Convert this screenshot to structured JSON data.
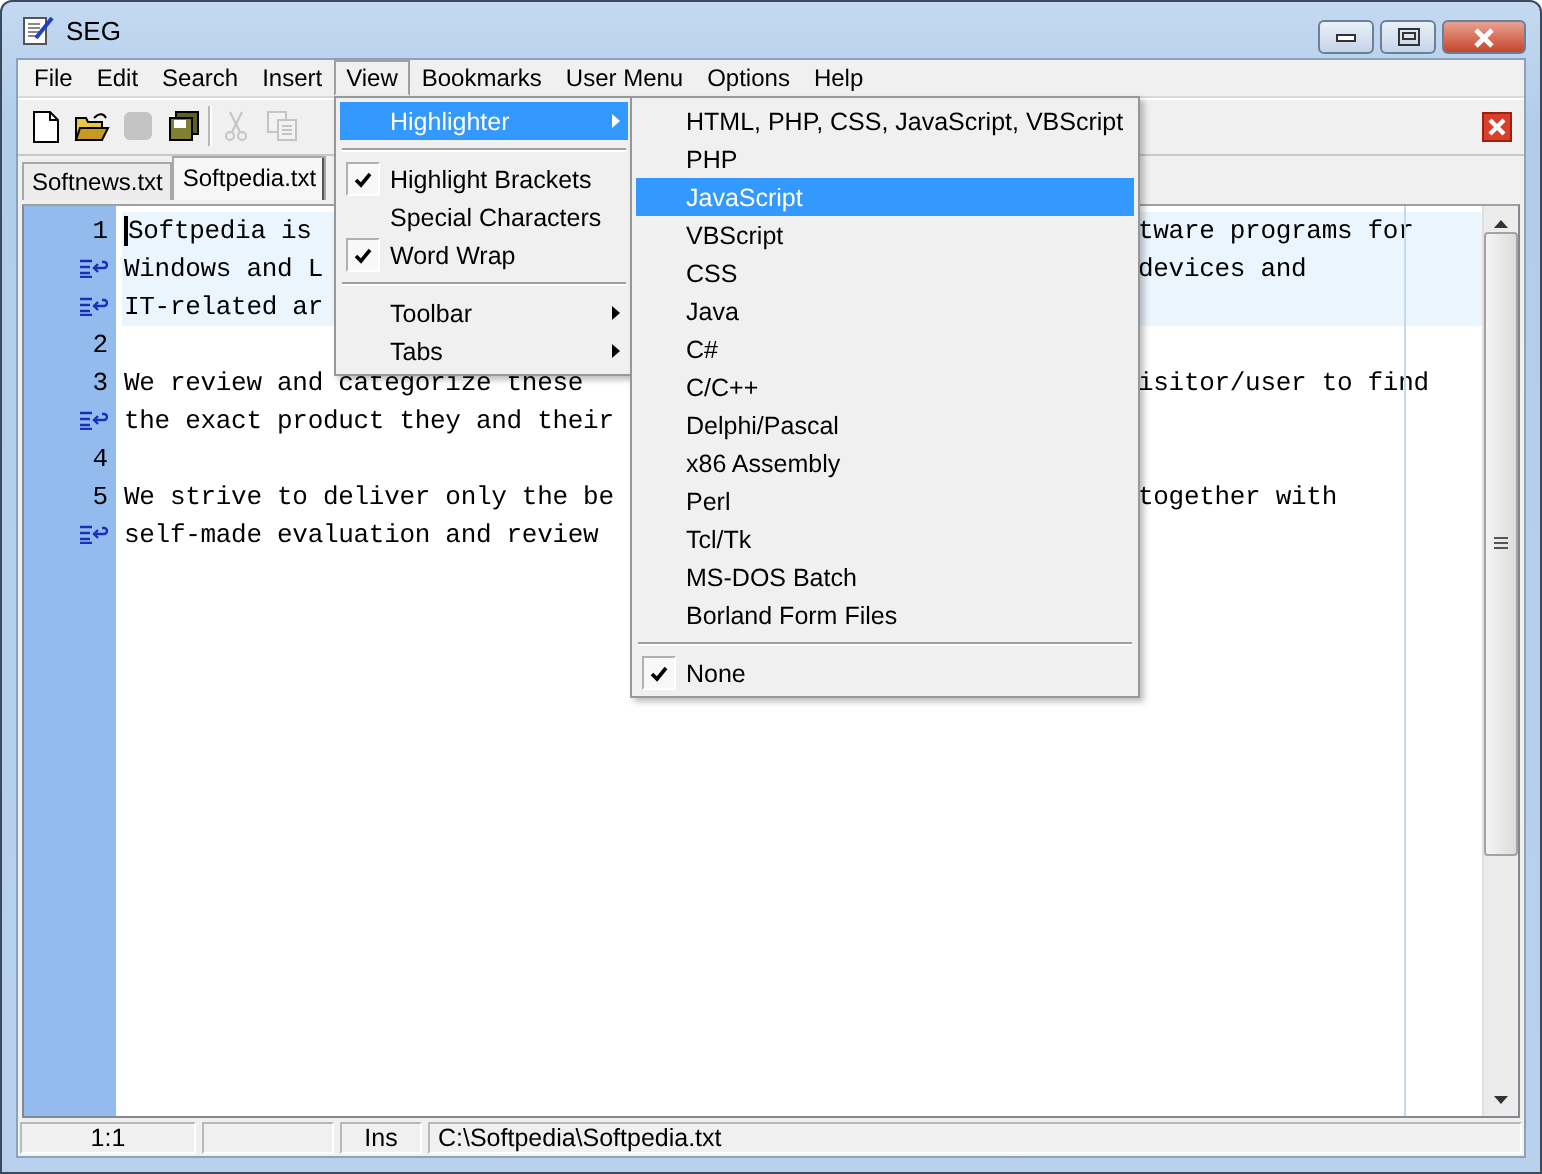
{
  "window": {
    "title": "SEG"
  },
  "menu_bar": [
    {
      "label": "File",
      "open": false
    },
    {
      "label": "Edit",
      "open": false
    },
    {
      "label": "Search",
      "open": false
    },
    {
      "label": "Insert",
      "open": false
    },
    {
      "label": "View",
      "open": true
    },
    {
      "label": "Bookmarks",
      "open": false
    },
    {
      "label": "User Menu",
      "open": false
    },
    {
      "label": "Options",
      "open": false
    },
    {
      "label": "Help",
      "open": false
    }
  ],
  "toolbar": [
    {
      "kind": "new",
      "disabled": false
    },
    {
      "kind": "open",
      "disabled": false
    },
    {
      "kind": "save",
      "disabled": true
    },
    {
      "kind": "save-all",
      "disabled": false
    },
    {
      "kind": "cut",
      "disabled": true
    },
    {
      "kind": "copy",
      "disabled": true
    }
  ],
  "tabs": [
    {
      "label": "Softnews.txt",
      "selected": false
    },
    {
      "label": "Softpedia.txt",
      "selected": true
    }
  ],
  "editor": {
    "lines": [
      {
        "kind": "line",
        "number": "1",
        "current": true,
        "text": "Softpedia is",
        "text_right": "tware programs for"
      },
      {
        "kind": "wrap",
        "current": true,
        "text": "Windows and L",
        "text_right": "devices and"
      },
      {
        "kind": "wrap",
        "current": true,
        "text": "IT-related ar"
      },
      {
        "kind": "line",
        "number": "2",
        "current": false
      },
      {
        "kind": "line",
        "number": "3",
        "current": false,
        "text": "We review and categorize these",
        "text_right": "isitor/user to find"
      },
      {
        "kind": "wrap",
        "current": false,
        "text": "the exact product they and their"
      },
      {
        "kind": "line",
        "number": "4",
        "current": false
      },
      {
        "kind": "line",
        "number": "5",
        "current": false,
        "text": "We strive to deliver only the be",
        "text_right": "together with"
      },
      {
        "kind": "wrap",
        "current": false,
        "text": "self-made evaluation and review"
      }
    ]
  },
  "view_menu": {
    "items": [
      {
        "kind": "item",
        "label": "Highlighter",
        "selected": true,
        "checked": false,
        "submenu": true
      },
      {
        "kind": "separator"
      },
      {
        "kind": "item",
        "label": "Highlight Brackets",
        "selected": false,
        "checked": true,
        "submenu": false
      },
      {
        "kind": "item",
        "label": "Special Characters",
        "selected": false,
        "checked": false,
        "submenu": false
      },
      {
        "kind": "item",
        "label": "Word Wrap",
        "selected": false,
        "checked": true,
        "submenu": false
      },
      {
        "kind": "separator"
      },
      {
        "kind": "item",
        "label": "Toolbar",
        "selected": false,
        "checked": false,
        "submenu": true
      },
      {
        "kind": "item",
        "label": "Tabs",
        "selected": false,
        "checked": false,
        "submenu": true
      }
    ]
  },
  "highlighter_menu": {
    "items": [
      {
        "kind": "item",
        "label": "HTML, PHP, CSS, JavaScript, VBScript",
        "selected": false,
        "checked": false
      },
      {
        "kind": "item",
        "label": "PHP",
        "selected": false,
        "checked": false
      },
      {
        "kind": "item",
        "label": "JavaScript",
        "selected": true,
        "checked": false
      },
      {
        "kind": "item",
        "label": "VBScript",
        "selected": false,
        "checked": false
      },
      {
        "kind": "item",
        "label": "CSS",
        "selected": false,
        "checked": false
      },
      {
        "kind": "item",
        "label": "Java",
        "selected": false,
        "checked": false
      },
      {
        "kind": "item",
        "label": "C#",
        "selected": false,
        "checked": false
      },
      {
        "kind": "item",
        "label": "C/C++",
        "selected": false,
        "checked": false
      },
      {
        "kind": "item",
        "label": "Delphi/Pascal",
        "selected": false,
        "checked": false
      },
      {
        "kind": "item",
        "label": "x86 Assembly",
        "selected": false,
        "checked": false
      },
      {
        "kind": "item",
        "label": "Perl",
        "selected": false,
        "checked": false
      },
      {
        "kind": "item",
        "label": "Tcl/Tk",
        "selected": false,
        "checked": false
      },
      {
        "kind": "item",
        "label": "MS-DOS Batch",
        "selected": false,
        "checked": false
      },
      {
        "kind": "item",
        "label": "Borland Form Files",
        "selected": false,
        "checked": false
      },
      {
        "kind": "separator"
      },
      {
        "kind": "item",
        "label": "None",
        "selected": false,
        "checked": true
      }
    ]
  },
  "status_bar": {
    "position": "1:1",
    "mode": "Ins",
    "path": "C:\\Softpedia\\Softpedia.txt"
  }
}
